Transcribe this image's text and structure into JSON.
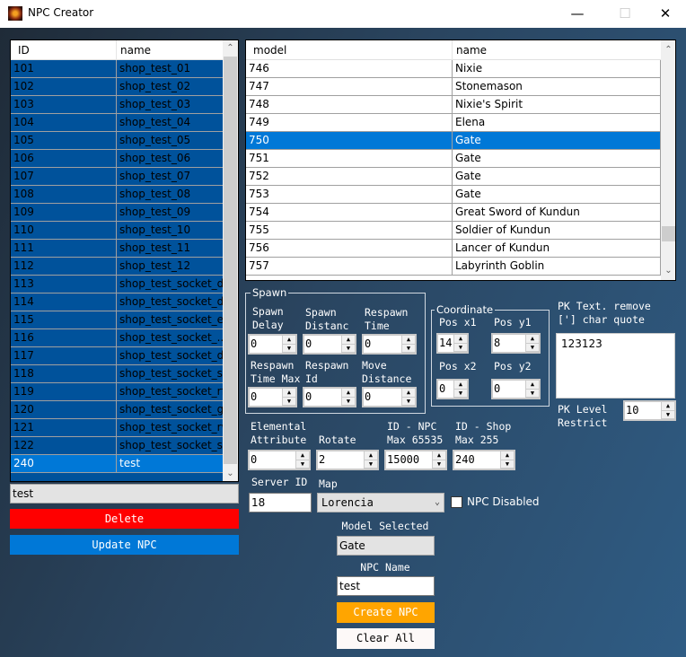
{
  "window": {
    "title": "NPC Creator",
    "minimize": "—",
    "maximize": "☐",
    "close": "✕"
  },
  "npc_list": {
    "columns": [
      "ID",
      "name"
    ],
    "rows": [
      [
        "101",
        "shop_test_01"
      ],
      [
        "102",
        "shop_test_02"
      ],
      [
        "103",
        "shop_test_03"
      ],
      [
        "104",
        "shop_test_04"
      ],
      [
        "105",
        "shop_test_05"
      ],
      [
        "106",
        "shop_test_06"
      ],
      [
        "107",
        "shop_test_07"
      ],
      [
        "108",
        "shop_test_08"
      ],
      [
        "109",
        "shop_test_09"
      ],
      [
        "110",
        "shop_test_10"
      ],
      [
        "111",
        "shop_test_11"
      ],
      [
        "112",
        "shop_test_12"
      ],
      [
        "113",
        "shop_test_socket_dw"
      ],
      [
        "114",
        "shop_test_socket_dk"
      ],
      [
        "115",
        "shop_test_socket_elf"
      ],
      [
        "116",
        "shop_test_socket_..."
      ],
      [
        "117",
        "shop_test_socket_dl"
      ],
      [
        "118",
        "shop_test_socket_s..."
      ],
      [
        "119",
        "shop_test_socket_rf"
      ],
      [
        "120",
        "shop_test_socket_gl"
      ],
      [
        "121",
        "shop_test_socket_rw"
      ],
      [
        "122",
        "shop_test_socket_sl"
      ],
      [
        "240",
        "test"
      ]
    ],
    "selected_index": 22
  },
  "model_list": {
    "columns": [
      "model",
      "name"
    ],
    "rows": [
      [
        "746",
        "Nixie"
      ],
      [
        "747",
        "Stonemason"
      ],
      [
        "748",
        "Nixie's Spirit"
      ],
      [
        "749",
        "Elena"
      ],
      [
        "750",
        "Gate"
      ],
      [
        "751",
        "Gate"
      ],
      [
        "752",
        "Gate"
      ],
      [
        "753",
        "Gate"
      ],
      [
        "754",
        "Great Sword of Kundun"
      ],
      [
        "755",
        "Soldier of Kundun"
      ],
      [
        "756",
        "Lancer of Kundun"
      ],
      [
        "757",
        "Labyrinth Goblin"
      ]
    ],
    "selected_index": 4
  },
  "search_value": "test",
  "delete_label": "Delete",
  "update_label": "Update NPC",
  "spawn": {
    "legend": "Spawn",
    "spawn_delay": {
      "label": "Spawn\nDelay",
      "value": "0"
    },
    "spawn_distance": {
      "label": "Spawn\nDistanc",
      "value": "0"
    },
    "respawn_time": {
      "label": "Respawn\nTime",
      "value": "0"
    },
    "respawn_time_max": {
      "label": "Respawn\nTime Max",
      "value": "0"
    },
    "respawn_id": {
      "label": "Respawn\nId",
      "value": "0"
    },
    "move_distance": {
      "label": "Move\nDistance",
      "value": "0"
    }
  },
  "coordinate": {
    "legend": "Coordinate",
    "x1": {
      "label": "Pos x1",
      "value": "14"
    },
    "y1": {
      "label": "Pos y1",
      "value": "8"
    },
    "x2": {
      "label": "Pos x2",
      "value": "0"
    },
    "y2": {
      "label": "Pos y2",
      "value": "0"
    }
  },
  "pk_text": {
    "label": "PK Text. remove\n['] char quote",
    "value": "123123"
  },
  "pk_level": {
    "label": "PK Level\nRestrict",
    "value": "10"
  },
  "elemental": {
    "label": "Elemental\nAttribute",
    "value": "0"
  },
  "rotate": {
    "label": "Rotate",
    "value": "2"
  },
  "id_npc": {
    "label": "ID - NPC\nMax 65535",
    "value": "15000"
  },
  "id_shop": {
    "label": "ID - Shop\nMax 255",
    "value": "240"
  },
  "server_id": {
    "label": "Server ID",
    "value": "18"
  },
  "map": {
    "label": "Map",
    "value": "Lorencia"
  },
  "npc_disabled": {
    "label": "NPC Disabled",
    "checked": false
  },
  "model_selected": {
    "label": "Model Selected",
    "value": "Gate"
  },
  "npc_name": {
    "label": "NPC Name",
    "value": "test"
  },
  "create_label": "Create NPC",
  "clear_label": "Clear All",
  "colors": {
    "delete": "#ff0000",
    "update": "#0078d7",
    "create": "#ffa500",
    "selection": "#0078d7"
  }
}
